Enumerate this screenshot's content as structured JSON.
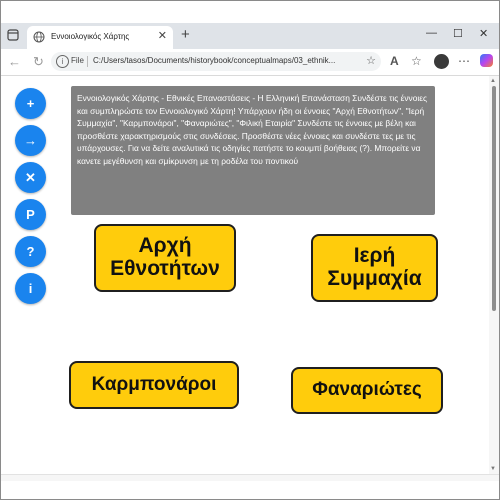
{
  "browser": {
    "tab_title": "Εννοιολογικός Χάρτης",
    "tab_close": "✕",
    "new_tab": "+",
    "window_controls": {
      "minimize": "—",
      "restore": "☐",
      "close": "✕"
    },
    "nav": {
      "back": "←",
      "forward": "→",
      "reload": "↻"
    },
    "address": {
      "scheme_label": "File",
      "info_icon": "i",
      "url": "C:/Users/tasos/Documents/historybook/conceptualmaps/03_ethnik...",
      "favorite_icon": "☆"
    },
    "toolbar_icons": [
      "reading-mode-icon",
      "favorites-icon",
      "collections-icon",
      "profile-avatar",
      "more-icon",
      "copilot-icon"
    ],
    "toolbar_glyphs": {
      "reading": "A",
      "favorites": "☆",
      "collections": "⧉",
      "more": "⋯"
    }
  },
  "sidebar": {
    "buttons": [
      {
        "name": "add-concept-button",
        "label": "+"
      },
      {
        "name": "connect-button",
        "label": "→"
      },
      {
        "name": "delete-button",
        "label": "✕"
      },
      {
        "name": "p-button",
        "label": "P"
      },
      {
        "name": "help-button",
        "label": "?"
      },
      {
        "name": "info-button",
        "label": "i"
      }
    ]
  },
  "instructions": {
    "text": "Εννοιολογικός Χάρτης - Εθνικές Επαναστάσεις - Η Ελληνική Επανάσταση Συνδέστε τις έννοιες και συμπληρώστε τον Εννοιολογικό Χάρτη! Υπάρχουν ήδη οι έννοιες \"Αρχή Εθνοτήτων\", \"Ιερή Συμμαχία\", \"Καρμπονάροι\", \"Φαναριώτες\", \"Φιλική Εταιρία\" Συνδέστε τις έννοιες με βέλη και προσθέστε χαρακτηρισμούς στις συνδέσεις. Προσθέστε νέες έννοιες και συνδέστε τες με τις υπάρχουσες. Για να δείτε αναλυτικά τις οδηγίες πατήστε το κουμπί βοήθειας (?). Μπορείτε να κανετε μεγέθυνση και σμίκρυνση με τη ροδέλα του ποντικού"
  },
  "concepts": [
    {
      "name": "concept-arxi-ethnotiton",
      "label": "Αρχή Εθνοτήτων"
    },
    {
      "name": "concept-ieri-symmaxia",
      "label": "Ιερή Συμμαχία"
    },
    {
      "name": "concept-karmponaroi",
      "label": "Καρμπονάροι"
    },
    {
      "name": "concept-fanariotes",
      "label": "Φαναριώτες"
    }
  ],
  "colors": {
    "accent": "#1a84ee",
    "concept_fill": "#ffcc0c",
    "panel": "#808080"
  }
}
